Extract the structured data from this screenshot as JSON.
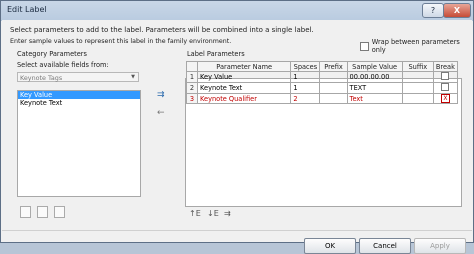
{
  "window": {
    "title": "Edit Label",
    "help_glyph": "?",
    "close_glyph": "X"
  },
  "instructions": {
    "line1": "Select parameters to add to the label.  Parameters will be combined into a single label.",
    "line2": "Enter sample values to represent this label in the family environment."
  },
  "wrap_option": {
    "label": "Wrap between parameters only",
    "checked": false
  },
  "category_group": {
    "title": "Category Parameters",
    "select_label": "Select available fields from:",
    "combo_value": "Keynote Tags",
    "items": [
      "Key Value",
      "Keynote Text"
    ],
    "selected_index": 0
  },
  "label_group": {
    "title": "Label Parameters",
    "columns": [
      "",
      "Parameter Name",
      "Spaces",
      "Prefix",
      "Sample Value",
      "Suffix",
      "Break"
    ],
    "rows": [
      {
        "num": "1",
        "name": "Key Value",
        "spaces": "1",
        "prefix": "",
        "sample": "00.00.00.00",
        "suffix": "",
        "break": false
      },
      {
        "num": "2",
        "name": "Keynote Text",
        "spaces": "1",
        "prefix": "",
        "sample": "TEXT",
        "suffix": "",
        "break": false
      },
      {
        "num": "3",
        "name": "Keynote Qualifier",
        "spaces": "2",
        "prefix": "",
        "sample": "Text",
        "suffix": "",
        "break": true
      }
    ]
  },
  "buttons": {
    "ok": "OK",
    "cancel": "Cancel",
    "apply": "Apply"
  },
  "glyphs": {
    "add": "⇉",
    "remove": "←",
    "move_up": "↑E",
    "move_down": "↓E",
    "edit": "⇉"
  }
}
